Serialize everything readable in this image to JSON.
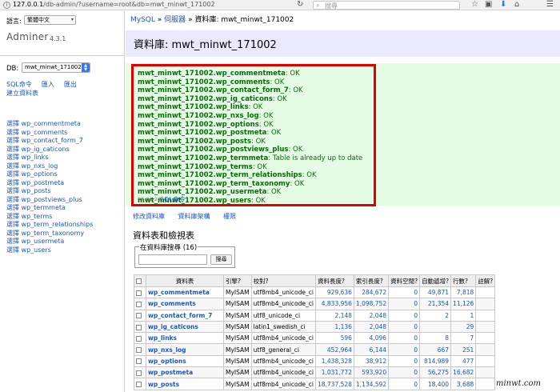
{
  "browser": {
    "url_prefix": "127.0.0.1",
    "url_rest": "/db-admin/?username=root&db=mwt_minwt_171002",
    "search_placeholder": "搜尋",
    "reload_icon": "↻",
    "search_icon": "⌕",
    "toolbar_icons": [
      "☆",
      "▣",
      "⬇",
      "⌂",
      "☰"
    ]
  },
  "sidebar": {
    "language_label": "語言:",
    "language_value": "繁體中文",
    "brand": "Adminer",
    "version": "4.3.1",
    "db_label": "DB:",
    "db_value": "mwt_minwt_171002",
    "commands": [
      "SQL命令",
      "匯入",
      "匯出",
      "建立資料表"
    ],
    "select_label": "選擇",
    "tables": [
      "wp_commentmeta",
      "wp_comments",
      "wp_contact_form_7",
      "wp_ig_caticons",
      "wp_links",
      "wp_nxs_log",
      "wp_options",
      "wp_postmeta",
      "wp_posts",
      "wp_postviews_plus",
      "wp_termmeta",
      "wp_terms",
      "wp_term_relationships",
      "wp_term_taxonomy",
      "wp_usermeta",
      "wp_users"
    ]
  },
  "breadcrumb": {
    "mysql": "MySQL",
    "server": "伺服器",
    "sep": "»",
    "current": "資料庫: mwt_minwt_171002"
  },
  "title": "資料庫: mwt_minwt_171002",
  "results": [
    {
      "table": "mwt_minwt_171002.wp_commentmeta",
      "msg": ": OK"
    },
    {
      "table": "mwt_minwt_171002.wp_comments",
      "msg": ": OK"
    },
    {
      "table": "mwt_minwt_171002.wp_contact_form_7",
      "msg": ": OK"
    },
    {
      "table": "mwt_minwt_171002.wp_ig_caticons",
      "msg": ": OK"
    },
    {
      "table": "mwt_minwt_171002.wp_links",
      "msg": ": OK"
    },
    {
      "table": "mwt_minwt_171002.wp_nxs_log",
      "msg": ": OK"
    },
    {
      "table": "mwt_minwt_171002.wp_options",
      "msg": ": OK"
    },
    {
      "table": "mwt_minwt_171002.wp_postmeta",
      "msg": ": OK"
    },
    {
      "table": "mwt_minwt_171002.wp_posts",
      "msg": ": OK"
    },
    {
      "table": "mwt_minwt_171002.wp_postviews_plus",
      "msg": ": OK"
    },
    {
      "table": "mwt_minwt_171002.wp_termmeta",
      "msg": ": Table is already up to date"
    },
    {
      "table": "mwt_minwt_171002.wp_terms",
      "msg": ": OK"
    },
    {
      "table": "mwt_minwt_171002.wp_term_relationships",
      "msg": ": OK"
    },
    {
      "table": "mwt_minwt_171002.wp_term_taxonomy",
      "msg": ": OK"
    },
    {
      "table": "mwt_minwt_171002.wp_usermeta",
      "msg": ": OK"
    },
    {
      "table": "mwt_minwt_171002.wp_users",
      "msg": ": OK"
    }
  ],
  "sql_time": "06:01:26",
  "sql_link": "SQL命令",
  "sub_links": [
    "修改資料庫",
    "資料庫架構",
    "權限"
  ],
  "section_title": "資料表和檢視表",
  "search": {
    "legend": "在資料庫搜尋 (16)",
    "button": "搜尋"
  },
  "table": {
    "headers": [
      "資料表",
      "引擎?",
      "校對?",
      "資料長度?",
      "索引長度?",
      "資料空閒?",
      "自動遞增?",
      "行數?",
      "註解?"
    ],
    "rows": [
      [
        "wp_commentmeta",
        "MyISAM",
        "utf8mb4_unicode_ci",
        "929,636",
        "284,672",
        "0",
        "49,871",
        "7,818",
        ""
      ],
      [
        "wp_comments",
        "MyISAM",
        "utf8mb4_unicode_ci",
        "4,833,956",
        "1,098,752",
        "0",
        "21,354",
        "11,126",
        ""
      ],
      [
        "wp_contact_form_7",
        "MyISAM",
        "utf8_unicode_ci",
        "2,148",
        "2,048",
        "0",
        "2",
        "1",
        ""
      ],
      [
        "wp_ig_caticons",
        "MyISAM",
        "latin1_swedish_ci",
        "1,136",
        "2,048",
        "0",
        "",
        "29",
        ""
      ],
      [
        "wp_links",
        "MyISAM",
        "utf8mb4_unicode_ci",
        "596",
        "4,096",
        "0",
        "8",
        "7",
        ""
      ],
      [
        "wp_nxs_log",
        "MyISAM",
        "utf8_general_ci",
        "452,964",
        "6,144",
        "0",
        "667",
        "251",
        ""
      ],
      [
        "wp_options",
        "MyISAM",
        "utf8mb4_unicode_ci",
        "1,438,328",
        "38,912",
        "0",
        "814,989",
        "477",
        ""
      ],
      [
        "wp_postmeta",
        "MyISAM",
        "utf8mb4_unicode_ci",
        "1,031,772",
        "593,920",
        "0",
        "56,275",
        "16,682",
        ""
      ],
      [
        "wp_posts",
        "MyISAM",
        "utf8mb4_unicode_ci",
        "18,737,528",
        "1,134,592",
        "0",
        "18,400",
        "3,688",
        ""
      ]
    ]
  },
  "watermark": "minwt.com"
}
